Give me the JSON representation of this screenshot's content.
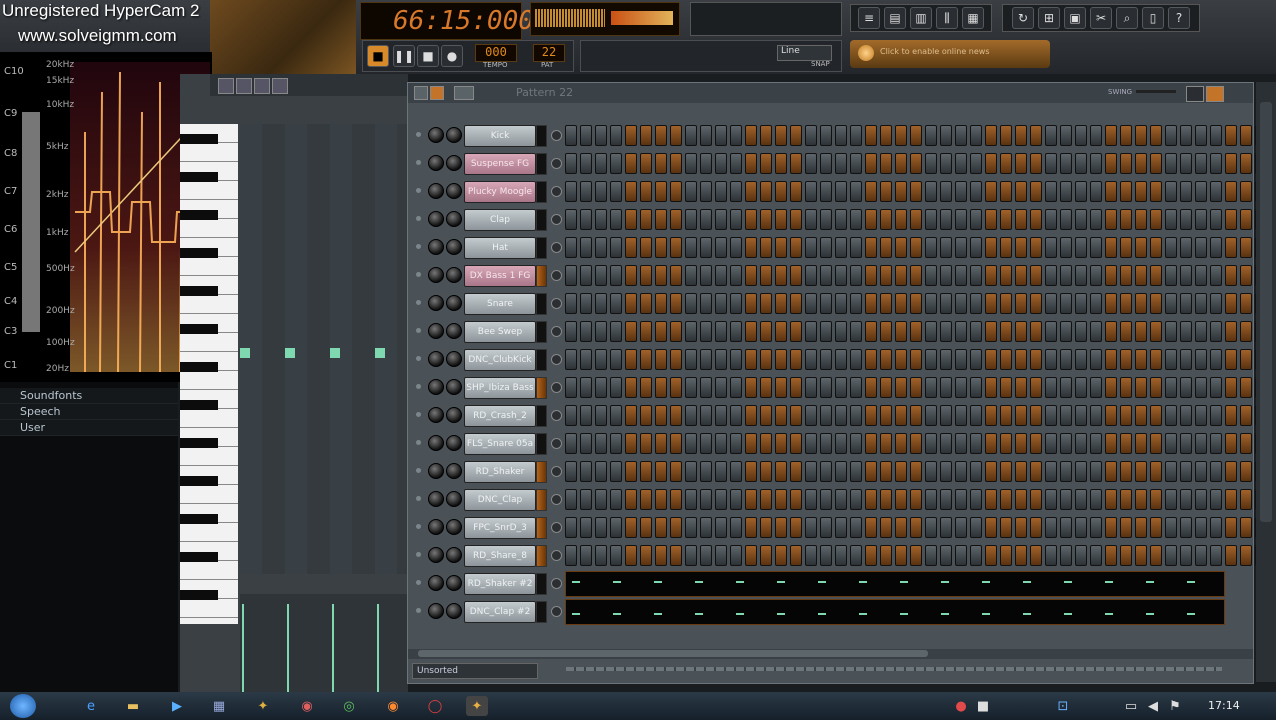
{
  "watermark": {
    "line1": "Unregistered HyperCam 2",
    "line2": "www.solveigmm.com"
  },
  "toolbar": {
    "time": "66:15:000",
    "tempo_label": "TEMPO",
    "pat_label": "PAT",
    "pat_value": "22",
    "tempo_value": "000",
    "snap_value": "Line",
    "snap_label": "SNAP",
    "hint_text": "Click to enable online news"
  },
  "spectrogram": {
    "octaves": [
      "C10",
      "C9",
      "C8",
      "C7",
      "C6",
      "C5",
      "C4",
      "C3",
      "C1"
    ],
    "freqs": [
      "20kHz",
      "15kHz",
      "10kHz",
      "5kHz",
      "2kHz",
      "1kHz",
      "500Hz",
      "200Hz",
      "100Hz",
      "20Hz"
    ]
  },
  "browser": {
    "items": [
      "Soundfonts",
      "Speech",
      "User"
    ]
  },
  "rack": {
    "title": "Pattern 22",
    "swing_label": "SWING",
    "filter_label": "Unsorted",
    "channels": [
      {
        "name": "Kick",
        "color": "grey",
        "hot": false
      },
      {
        "name": "Suspense FG",
        "color": "pink",
        "hot": false
      },
      {
        "name": "Plucky Moogle",
        "color": "pink",
        "hot": false
      },
      {
        "name": "Clap",
        "color": "grey",
        "hot": false
      },
      {
        "name": "Hat",
        "color": "grey",
        "hot": false
      },
      {
        "name": "DX Bass 1 FG",
        "color": "pink",
        "hot": true
      },
      {
        "name": "Snare",
        "color": "grey",
        "hot": false
      },
      {
        "name": "Bee Swep",
        "color": "grey",
        "hot": false
      },
      {
        "name": "DNC_ClubKick",
        "color": "grey",
        "hot": false
      },
      {
        "name": "SHP_Ibiza Bass",
        "color": "grey",
        "hot": true
      },
      {
        "name": "RD_Crash_2",
        "color": "grey",
        "hot": false
      },
      {
        "name": "FLS_Snare 05a",
        "color": "grey",
        "hot": false
      },
      {
        "name": "RD_Shaker",
        "color": "grey",
        "hot": true
      },
      {
        "name": "DNC_Clap",
        "color": "grey",
        "hot": true
      },
      {
        "name": "FPC_SnrD_3",
        "color": "grey",
        "hot": true
      },
      {
        "name": "RD_Share_8",
        "color": "grey",
        "hot": true
      },
      {
        "name": "RD_Shaker #2",
        "color": "grey",
        "hot": false,
        "piano": true
      },
      {
        "name": "DNC_Clap #2",
        "color": "grey",
        "hot": false,
        "piano": true
      }
    ]
  },
  "taskbar": {
    "clock": "17:14"
  },
  "colors": {
    "orange_step": "#a1622a",
    "grey_step": "#5e666b",
    "rack_bg": "#4a5257"
  }
}
